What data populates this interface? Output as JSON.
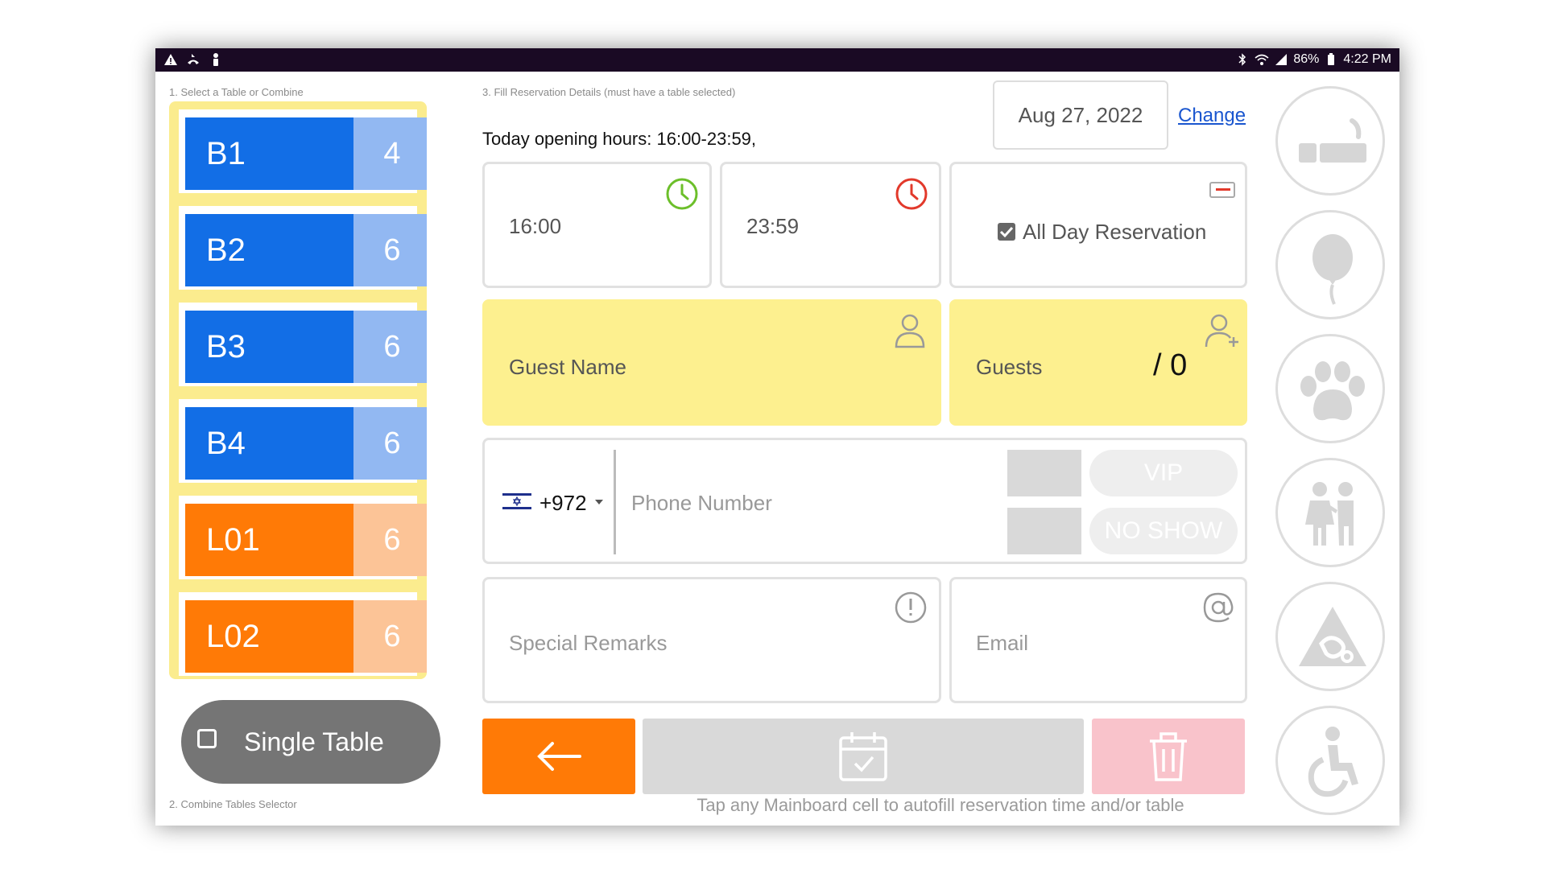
{
  "status_bar": {
    "battery": "86%",
    "time": "4:22 PM",
    "left_icons": [
      "warning-icon",
      "call-forward-icon",
      "figure-icon"
    ],
    "right_icons": [
      "bluetooth-icon",
      "wifi-icon",
      "signal-icon",
      "battery-icon"
    ]
  },
  "left_panel": {
    "step1_label": "1. Select a Table or Combine",
    "tables": [
      {
        "name": "B1",
        "capacity": "4",
        "color": "blue"
      },
      {
        "name": "B2",
        "capacity": "6",
        "color": "blue"
      },
      {
        "name": "B3",
        "capacity": "6",
        "color": "blue"
      },
      {
        "name": "B4",
        "capacity": "6",
        "color": "blue"
      },
      {
        "name": "L01",
        "capacity": "6",
        "color": "orange"
      },
      {
        "name": "L02",
        "capacity": "6",
        "color": "orange"
      }
    ],
    "single_table_label": "Single Table",
    "single_table_checked": false,
    "step2_label": "2. Combine Tables Selector"
  },
  "form": {
    "step3_label": "3. Fill Reservation Details (must have a table selected)",
    "opening_hours": "Today opening hours: 16:00-23:59,",
    "date": "Aug 27, 2022",
    "change_label": "Change",
    "start_time": "16:00",
    "end_time": "23:59",
    "all_day_label": "All Day Reservation",
    "all_day_checked": true,
    "guest_name_placeholder": "Guest Name",
    "guests_label": "Guests",
    "guests_count": "/ 0",
    "country_code": "+972",
    "phone_placeholder": "Phone Number",
    "vip_label": "VIP",
    "no_show_label": "NO SHOW",
    "remarks_placeholder": "Special Remarks",
    "email_placeholder": "Email",
    "tap_note": "Tap any Mainboard cell to autofill reservation time and/or table"
  },
  "side_icons": [
    "smoking-icon",
    "balloon-icon",
    "paw-icon",
    "children-icon",
    "allergy-icon",
    "wheelchair-icon"
  ],
  "colors": {
    "blue": "#126ee6",
    "blue_light": "#92b8f2",
    "orange": "#ff7a06",
    "orange_light": "#fcc497",
    "yellow": "#fdf08f",
    "status_bar": "#1a0a24",
    "delete_pink": "#f9c3cb"
  }
}
